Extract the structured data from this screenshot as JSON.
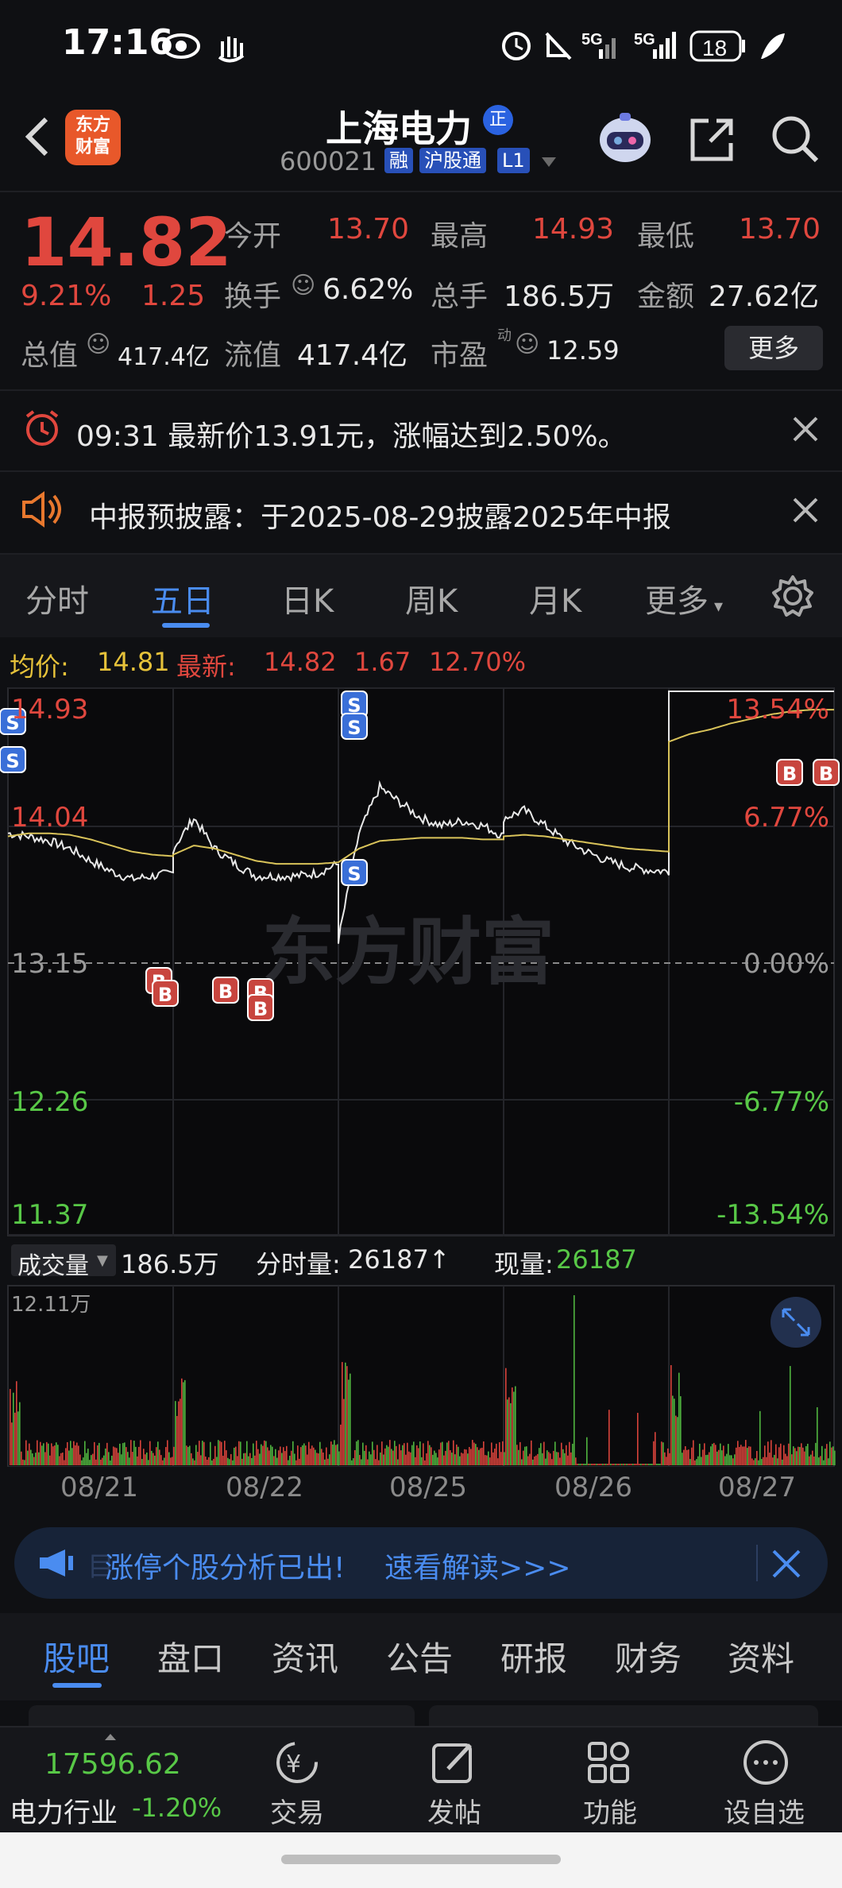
{
  "status_bar": {
    "time": "17:16",
    "battery": "18",
    "net1": "5G",
    "net2": "5G"
  },
  "header": {
    "name": "上海电力",
    "badge": "正",
    "code": "600021",
    "tag1": "融",
    "tag2": "沪股通",
    "tag3": "L1",
    "logo_line1": "东方",
    "logo_line2": "财富"
  },
  "quote": {
    "price": "14.82",
    "change_pct": "9.21%",
    "change": "1.25",
    "open_label": "今开",
    "open": "13.70",
    "high_label": "最高",
    "high": "14.93",
    "low_label": "最低",
    "low": "13.70",
    "turnover_label": "换手",
    "turnover": "6.62%",
    "volume_label": "总手",
    "volume": "186.5万",
    "amount_label": "金额",
    "amount": "27.62亿",
    "mktcap_label": "总值",
    "mktcap": "417.4亿",
    "float_label": "流值",
    "float": "417.4亿",
    "pe_label": "市盈",
    "pe_sup": "动",
    "pe": "12.59",
    "more": "更多"
  },
  "alerts": [
    {
      "text": "09:31 最新价13.91元，涨幅达到2.50%。"
    },
    {
      "text": "中报预披露：于2025-08-29披露2025年中报"
    }
  ],
  "tabs": [
    "分时",
    "五日",
    "日K",
    "周K",
    "月K",
    "更多"
  ],
  "chart_header": {
    "avg_label": "均价:",
    "avg": "14.81",
    "latest_label": "最新:",
    "latest": "14.82",
    "chg": "1.67",
    "pct": "12.70%"
  },
  "chart": {
    "y_left": [
      "14.93",
      "14.04",
      "13.15",
      "12.26",
      "11.37"
    ],
    "y_right": [
      "13.54%",
      "6.77%",
      "0.00%",
      "-6.77%",
      "-13.54%"
    ],
    "watermark": "东方财富"
  },
  "volume_bar": {
    "selector": "成交量",
    "total": "186.5万",
    "fen_label": "分时量:",
    "fen": "26187↑",
    "now_label": "现量:",
    "now": "26187",
    "max": "12.11万"
  },
  "dates": [
    "08/21",
    "08/22",
    "08/25",
    "08/26",
    "08/27"
  ],
  "banner": {
    "icon_text": "目",
    "text": "涨停个股分析已出!",
    "link": "速看解读>>>"
  },
  "bottom_tabs": [
    "股吧",
    "盘口",
    "资讯",
    "公告",
    "研报",
    "财务",
    "资料"
  ],
  "bottom_bar": {
    "index_value": "17596.62",
    "index_name": "电力行业",
    "index_pct": "-1.20%",
    "trade": "交易",
    "post": "发帖",
    "func": "功能",
    "self": "设自选"
  },
  "chart_data": {
    "type": "line",
    "title": "",
    "xlabel": "",
    "ylabel": "",
    "x": [
      "08/21",
      "08/22",
      "08/25",
      "08/26",
      "08/27"
    ],
    "ylim": [
      11.37,
      14.93
    ],
    "reference": 13.15,
    "series": [
      {
        "name": "",
        "values": [
          13.98,
          13.75,
          13.95,
          13.95,
          14.93
        ]
      },
      {
        "name": "均价",
        "values": [
          13.97,
          13.8,
          13.88,
          13.95,
          14.81
        ]
      }
    ]
  }
}
